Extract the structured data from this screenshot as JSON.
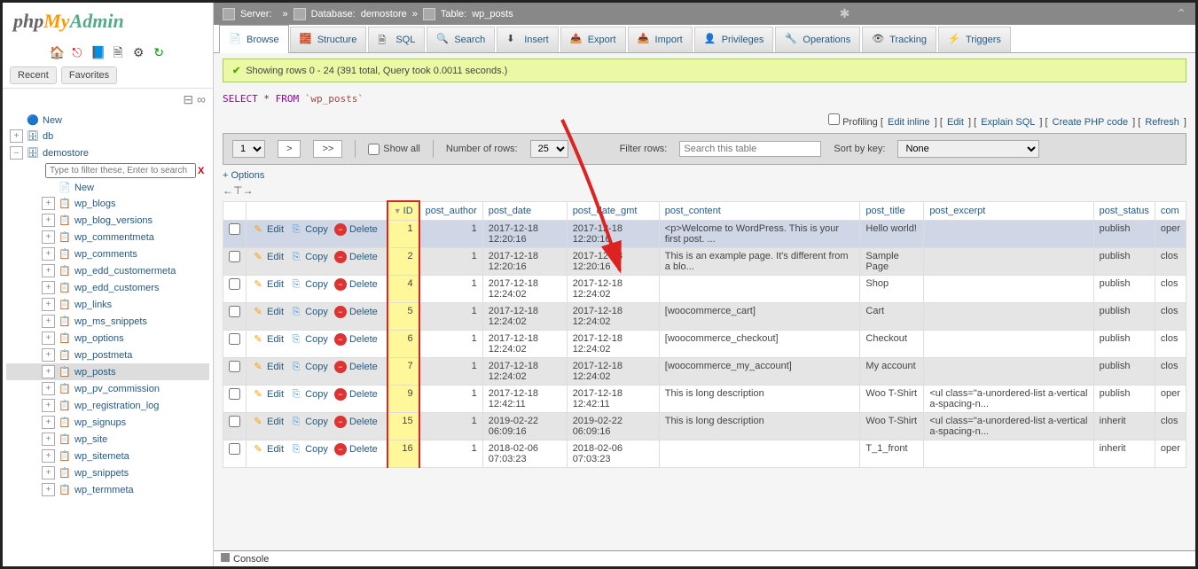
{
  "logo": {
    "php": "php",
    "my": "My",
    "admin": "Admin"
  },
  "sidebar": {
    "recent": "Recent",
    "favorites": "Favorites",
    "filter_placeholder": "Type to filter these, Enter to search",
    "new_label": "New",
    "nodes": [
      {
        "label": "New",
        "level": 1,
        "expand": "",
        "ico": "🔵"
      },
      {
        "label": "db",
        "level": 1,
        "expand": "+",
        "ico": "🗄"
      },
      {
        "label": "demostore",
        "level": 1,
        "expand": "–",
        "ico": "🗄"
      },
      {
        "label": "New",
        "level": 3,
        "expand": "",
        "ico": "📄",
        "filter_above": true
      },
      {
        "label": "wp_blogs",
        "level": 3,
        "expand": "+",
        "ico": "📋"
      },
      {
        "label": "wp_blog_versions",
        "level": 3,
        "expand": "+",
        "ico": "📋"
      },
      {
        "label": "wp_commentmeta",
        "level": 3,
        "expand": "+",
        "ico": "📋"
      },
      {
        "label": "wp_comments",
        "level": 3,
        "expand": "+",
        "ico": "📋"
      },
      {
        "label": "wp_edd_customermeta",
        "level": 3,
        "expand": "+",
        "ico": "📋"
      },
      {
        "label": "wp_edd_customers",
        "level": 3,
        "expand": "+",
        "ico": "📋"
      },
      {
        "label": "wp_links",
        "level": 3,
        "expand": "+",
        "ico": "📋"
      },
      {
        "label": "wp_ms_snippets",
        "level": 3,
        "expand": "+",
        "ico": "📋"
      },
      {
        "label": "wp_options",
        "level": 3,
        "expand": "+",
        "ico": "📋"
      },
      {
        "label": "wp_postmeta",
        "level": 3,
        "expand": "+",
        "ico": "📋"
      },
      {
        "label": "wp_posts",
        "level": 3,
        "expand": "+",
        "ico": "📋",
        "active": true
      },
      {
        "label": "wp_pv_commission",
        "level": 3,
        "expand": "+",
        "ico": "📋"
      },
      {
        "label": "wp_registration_log",
        "level": 3,
        "expand": "+",
        "ico": "📋"
      },
      {
        "label": "wp_signups",
        "level": 3,
        "expand": "+",
        "ico": "📋"
      },
      {
        "label": "wp_site",
        "level": 3,
        "expand": "+",
        "ico": "📋"
      },
      {
        "label": "wp_sitemeta",
        "level": 3,
        "expand": "+",
        "ico": "📋"
      },
      {
        "label": "wp_snippets",
        "level": 3,
        "expand": "+",
        "ico": "📋"
      },
      {
        "label": "wp_termmeta",
        "level": 3,
        "expand": "+",
        "ico": "📋"
      }
    ]
  },
  "breadcrumb": {
    "server_label": "Server:",
    "server_value": "",
    "database_label": "Database:",
    "database_value": "demostore",
    "table_label": "Table:",
    "table_value": "wp_posts"
  },
  "tabs": [
    {
      "label": "Browse",
      "active": true
    },
    {
      "label": "Structure"
    },
    {
      "label": "SQL"
    },
    {
      "label": "Search"
    },
    {
      "label": "Insert"
    },
    {
      "label": "Export"
    },
    {
      "label": "Import"
    },
    {
      "label": "Privileges"
    },
    {
      "label": "Operations"
    },
    {
      "label": "Tracking"
    },
    {
      "label": "Triggers"
    }
  ],
  "success_message": "Showing rows 0 - 24 (391 total, Query took 0.0011 seconds.)",
  "query": {
    "select": "SELECT",
    "star": "*",
    "from": "FROM",
    "table": "`wp_posts`"
  },
  "action_links": {
    "profiling": "Profiling",
    "edit_inline": "Edit inline",
    "edit": "Edit",
    "explain": "Explain SQL",
    "php": "Create PHP code",
    "refresh": "Refresh"
  },
  "controls": {
    "page": "1",
    "next_btn": ">",
    "last_btn": ">>",
    "show_all": "Show all",
    "num_rows_label": "Number of rows:",
    "num_rows": "25",
    "filter_label": "Filter rows:",
    "filter_placeholder": "Search this table",
    "sort_label": "Sort by key:",
    "sort_value": "None"
  },
  "options_link": "+ Options",
  "table_tools": "←⊤→",
  "columns": [
    "ID",
    "post_author",
    "post_date",
    "post_date_gmt",
    "post_content",
    "post_title",
    "post_excerpt",
    "post_status",
    "com"
  ],
  "row_action_labels": {
    "edit": "Edit",
    "copy": "Copy",
    "delete": "Delete"
  },
  "rows": [
    {
      "id": "1",
      "author": "1",
      "date": "2017-12-18 12:20:16",
      "gmt": "2017-12-18 12:20:16",
      "content": "<p>Welcome to WordPress. This is your first post. ...",
      "title": "Hello world!",
      "excerpt": "",
      "status": "publish",
      "com": "oper",
      "hover": true
    },
    {
      "id": "2",
      "author": "1",
      "date": "2017-12-18 12:20:16",
      "gmt": "2017-12-18 12:20:16",
      "content": "This is an example page. It's different from a blo...",
      "title": "Sample Page",
      "excerpt": "",
      "status": "publish",
      "com": "clos"
    },
    {
      "id": "4",
      "author": "1",
      "date": "2017-12-18 12:24:02",
      "gmt": "2017-12-18 12:24:02",
      "content": "",
      "title": "Shop",
      "excerpt": "",
      "status": "publish",
      "com": "clos"
    },
    {
      "id": "5",
      "author": "1",
      "date": "2017-12-18 12:24:02",
      "gmt": "2017-12-18 12:24:02",
      "content": "[woocommerce_cart]",
      "title": "Cart",
      "excerpt": "",
      "status": "publish",
      "com": "clos"
    },
    {
      "id": "6",
      "author": "1",
      "date": "2017-12-18 12:24:02",
      "gmt": "2017-12-18 12:24:02",
      "content": "[woocommerce_checkout]",
      "title": "Checkout",
      "excerpt": "",
      "status": "publish",
      "com": "clos"
    },
    {
      "id": "7",
      "author": "1",
      "date": "2017-12-18 12:24:02",
      "gmt": "2017-12-18 12:24:02",
      "content": "[woocommerce_my_account]",
      "title": "My account",
      "excerpt": "",
      "status": "publish",
      "com": "clos"
    },
    {
      "id": "9",
      "author": "1",
      "date": "2017-12-18 12:42:11",
      "gmt": "2017-12-18 12:42:11",
      "content": "This is long description",
      "title": "Woo T-Shirt",
      "excerpt": "<ul class=\"a-unordered-list a-vertical a-spacing-n...",
      "status": "publish",
      "com": "oper"
    },
    {
      "id": "15",
      "author": "1",
      "date": "2019-02-22 06:09:16",
      "gmt": "2019-02-22 06:09:16",
      "content": "This is long description",
      "title": "Woo T-Shirt",
      "excerpt": "<ul class=\"a-unordered-list a-vertical a-spacing-n...",
      "status": "inherit",
      "com": "clos"
    },
    {
      "id": "16",
      "author": "1",
      "date": "2018-02-06 07:03:23",
      "gmt": "2018-02-06 07:03:23",
      "content": "",
      "title": "T_1_front",
      "excerpt": "",
      "status": "inherit",
      "com": "oper"
    }
  ],
  "console_label": "Console"
}
